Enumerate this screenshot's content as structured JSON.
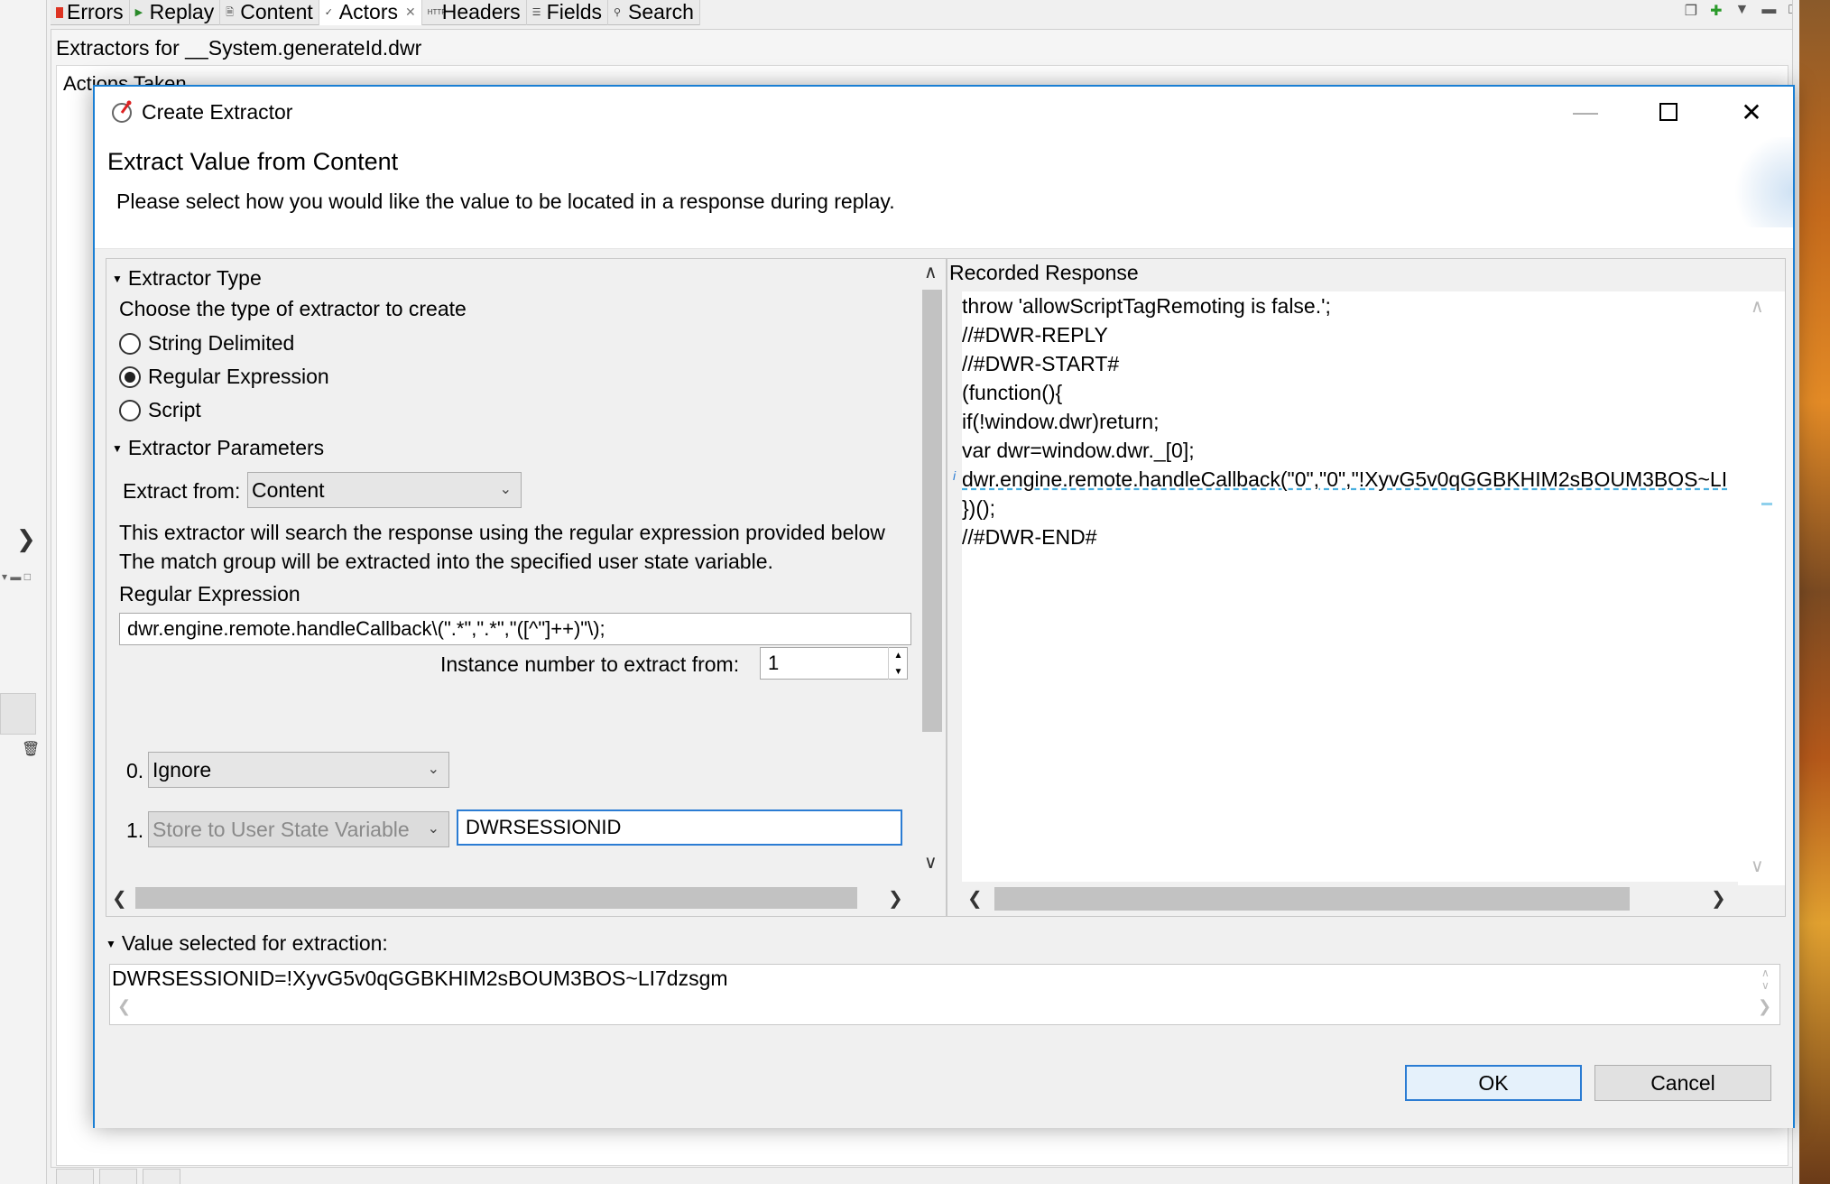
{
  "background": {
    "tabs": [
      {
        "label": "Errors",
        "icon": "error-icon"
      },
      {
        "label": "Replay",
        "icon": "play-icon"
      },
      {
        "label": "Content",
        "icon": "document-icon"
      },
      {
        "label": "Actors",
        "icon": "check-icon"
      },
      {
        "label": "Headers",
        "icon": "http-icon"
      },
      {
        "label": "Fields",
        "icon": "list-icon"
      },
      {
        "label": "Search",
        "icon": "search-icon"
      }
    ],
    "panel_title": "Extractors for __System.generateId.dwr",
    "actions_label": "Actions Taken"
  },
  "dialog": {
    "title": "Create Extractor",
    "header_title": "Extract Value from Content",
    "header_desc": "Please select how you would like the value to be located in a response during replay.",
    "extractor_type": {
      "heading": "Extractor Type",
      "prompt": "Choose the type of extractor to create",
      "options": [
        "String Delimited",
        "Regular Expression",
        "Script"
      ],
      "selected": "Regular Expression"
    },
    "params": {
      "heading": "Extractor Parameters",
      "extract_from_label": "Extract from:",
      "extract_from_value": "Content",
      "help_line1": "This extractor will search the response using the regular expression provided below",
      "help_line2": "The match group will be extracted into the specified user state variable.",
      "regex_label": "Regular Expression",
      "regex_value": "dwr.engine.remote.handleCallback\\(\".*\",\".*\",\"([^\"]++)\"\\);",
      "instance_label": "Instance number to extract from:",
      "instance_value": "1",
      "group0_index": "0.",
      "group0_action": "Ignore",
      "group1_index": "1.",
      "group1_action": "Store to User State Variable",
      "group1_var": "DWRSESSIONID"
    },
    "recorded": {
      "heading": "Recorded Response",
      "lines": [
        "throw 'allowScriptTagRemoting is false.';",
        "//#DWR-REPLY",
        "//#DWR-START#",
        "(function(){",
        "if(!window.dwr)return;",
        "var dwr=window.dwr._[0];",
        "dwr.engine.remote.handleCallback(\"0\",\"0\",\"!XyvG5v0qGGBKHIM2sBOUM3BOS~LI",
        "})();",
        "//#DWR-END#"
      ]
    },
    "value_section": {
      "heading": "Value selected for extraction:",
      "value": "DWRSESSIONID=!XyvG5v0qGGBKHIM2sBOUM3BOS~LI7dzsgm"
    },
    "buttons": {
      "ok": "OK",
      "cancel": "Cancel"
    }
  }
}
